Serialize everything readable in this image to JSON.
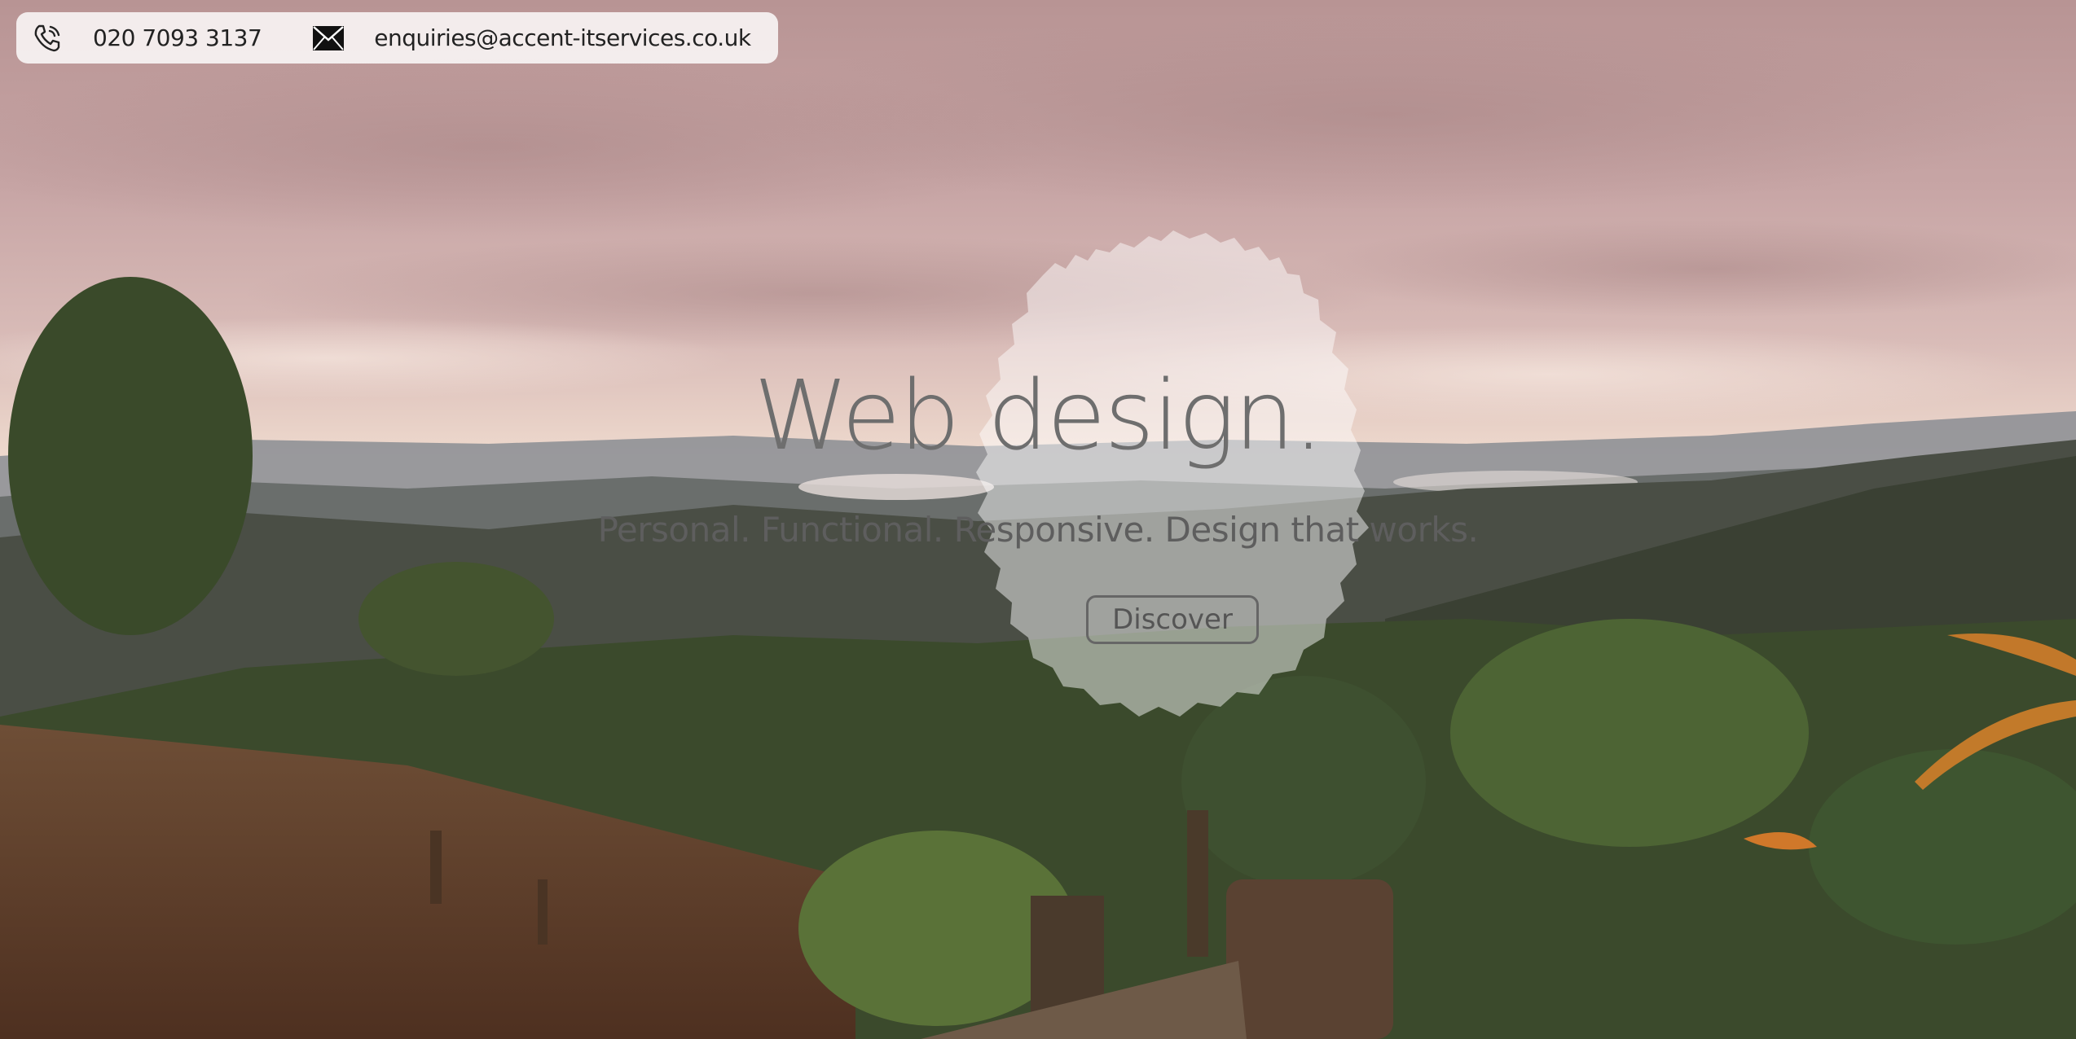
{
  "contact": {
    "phone": "020 7093 3137",
    "email": "enquiries@accent-itservices.co.uk",
    "phone_icon": "phone-icon",
    "email_icon": "envelope-icon"
  },
  "hero": {
    "title": "Web design.",
    "subtitle": "Personal. Functional. Responsive. Design that works.",
    "button_label": "Discover"
  },
  "colors": {
    "sky": "#c9a9a8",
    "hills": "#4a4d45",
    "grass": "#6b4a33",
    "blob": "#ffffff",
    "text": "#6e6e6e"
  }
}
